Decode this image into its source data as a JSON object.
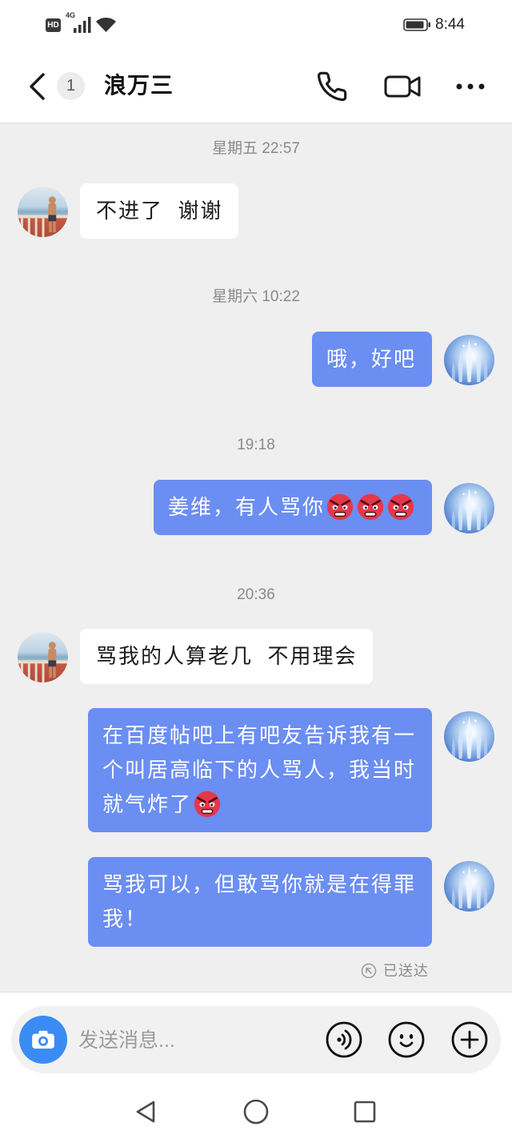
{
  "status_bar": {
    "hd_badge": "HD",
    "network_type": "4G",
    "time": "8:44",
    "icons": [
      "signal-icon",
      "wifi-icon",
      "battery-icon"
    ]
  },
  "header": {
    "back_badge": "1",
    "title": "浪万三",
    "icons": [
      "back-chevron-icon",
      "phone-icon",
      "video-call-icon",
      "more-icon"
    ]
  },
  "chat": {
    "timestamps": [
      "星期五 22:57",
      "星期六 10:22",
      "19:18",
      "20:36"
    ],
    "messages": [
      {
        "lines": [
          "不进了  谢谢"
        ],
        "emoji": []
      },
      {
        "lines": [
          "哦，好吧"
        ],
        "emoji": []
      },
      {
        "lines": [
          "姜维，有人骂你"
        ],
        "emoji": [
          "angry-face-emoji",
          "angry-face-emoji",
          "angry-face-emoji"
        ]
      },
      {
        "lines": [
          "骂我的人算老几  不用理会"
        ],
        "emoji": []
      },
      {
        "lines": [
          "在百度帖吧上有吧友告诉我有一",
          "个叫居高临下的人骂人，我当时",
          "就气炸了"
        ],
        "emoji": [
          "angry-face-emoji"
        ]
      },
      {
        "lines": [
          "骂我可以，但敢骂你就是在得罪",
          "我！"
        ],
        "emoji": []
      }
    ],
    "delivery_status": "已送达"
  },
  "input_bar": {
    "placeholder": "发送消息...",
    "icons": [
      "camera-icon",
      "voice-icon",
      "emoji-icon",
      "plus-icon"
    ]
  },
  "nav_bar": {
    "icons": [
      "back-triangle-icon",
      "home-circle-icon",
      "recents-square-icon"
    ]
  },
  "colors": {
    "sent_bubble": "#6b8ef2",
    "received_bubble": "#ffffff",
    "chat_background": "#efefef",
    "camera_button": "#3a8cf4",
    "emoji_red": "#e5384b"
  }
}
